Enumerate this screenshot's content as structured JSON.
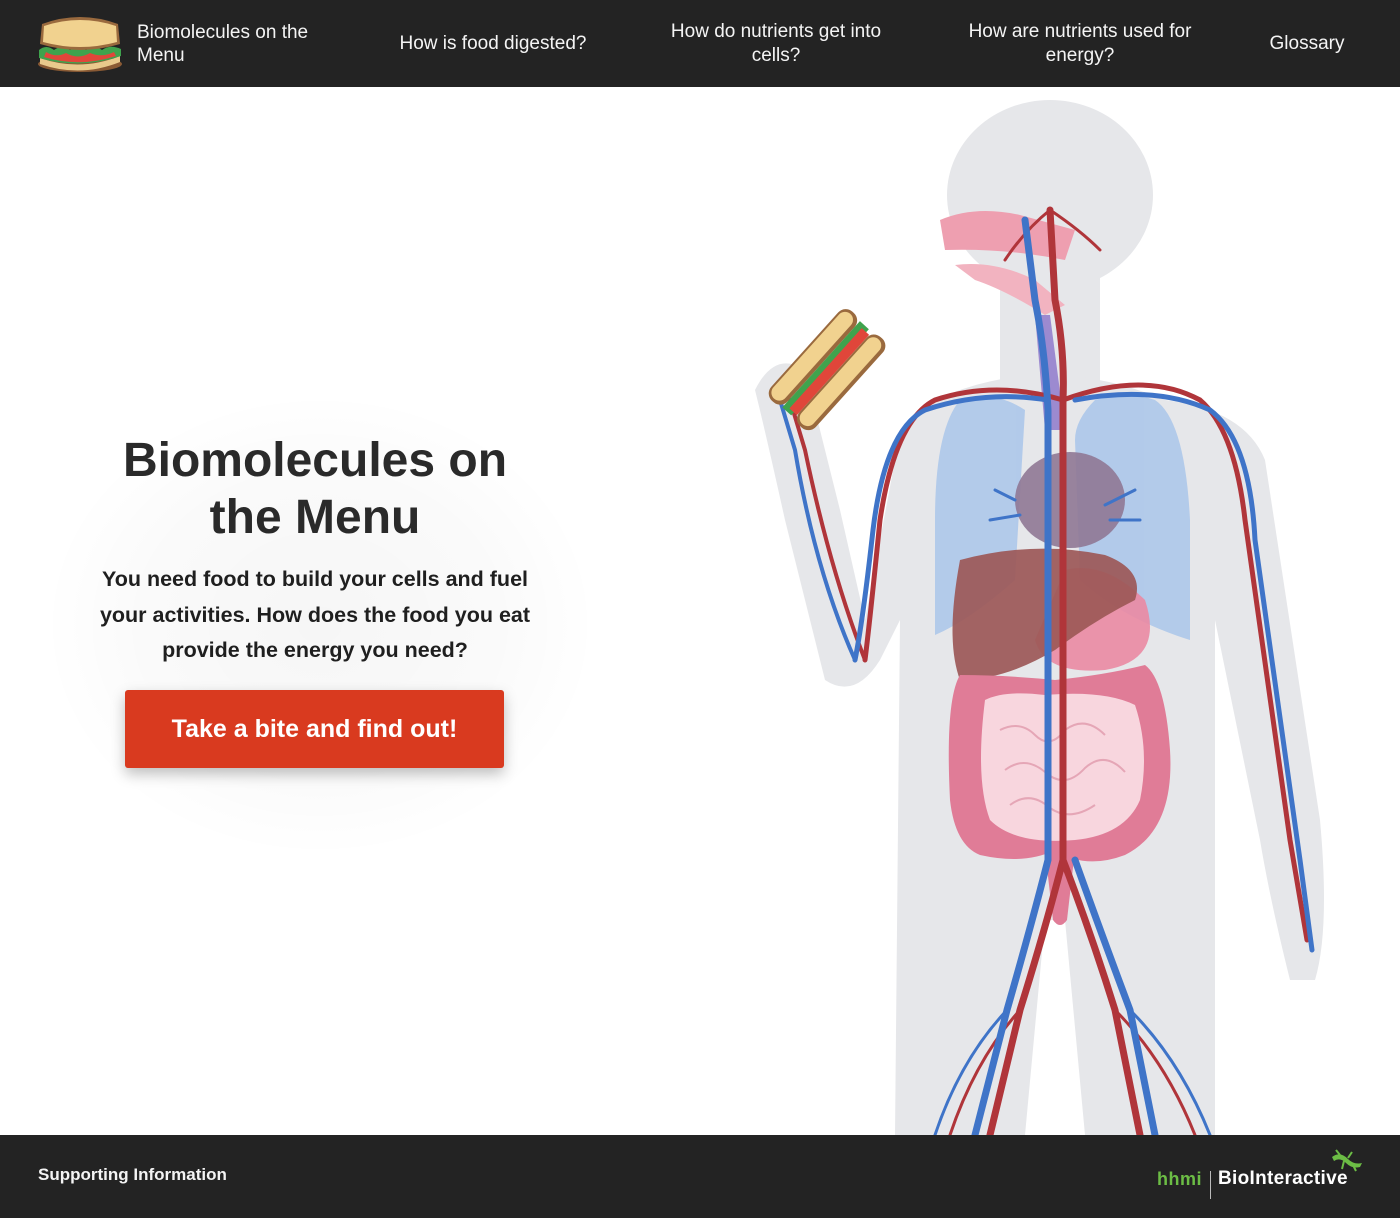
{
  "nav": {
    "brand_label": "Biomolecules on the Menu",
    "brand_icon": "sandwich-icon",
    "links": [
      {
        "label": "How is food digested?"
      },
      {
        "label": "How do nutrients get into cells?"
      },
      {
        "label": "How are nutrients used for energy?"
      },
      {
        "label": "Glossary"
      }
    ]
  },
  "hero": {
    "title": "Biomolecules on the Menu",
    "description": "You need food to build your cells and fuel your activities. How does the food you eat provide the energy you need?",
    "cta_label": "Take a bite and find out!",
    "illustration": "human-body-digestive-circulatory-illustration"
  },
  "footer": {
    "supporting_label": "Supporting Information",
    "logo_hhmi": "hhmi",
    "logo_brand": "BioInteractive"
  },
  "colors": {
    "nav_bg": "#232323",
    "accent": "#d93a1f",
    "artery": "#b0353a",
    "vein": "#3f74c8",
    "body_silhouette": "#e6e7ea",
    "hhmi_green": "#6cbd45"
  }
}
